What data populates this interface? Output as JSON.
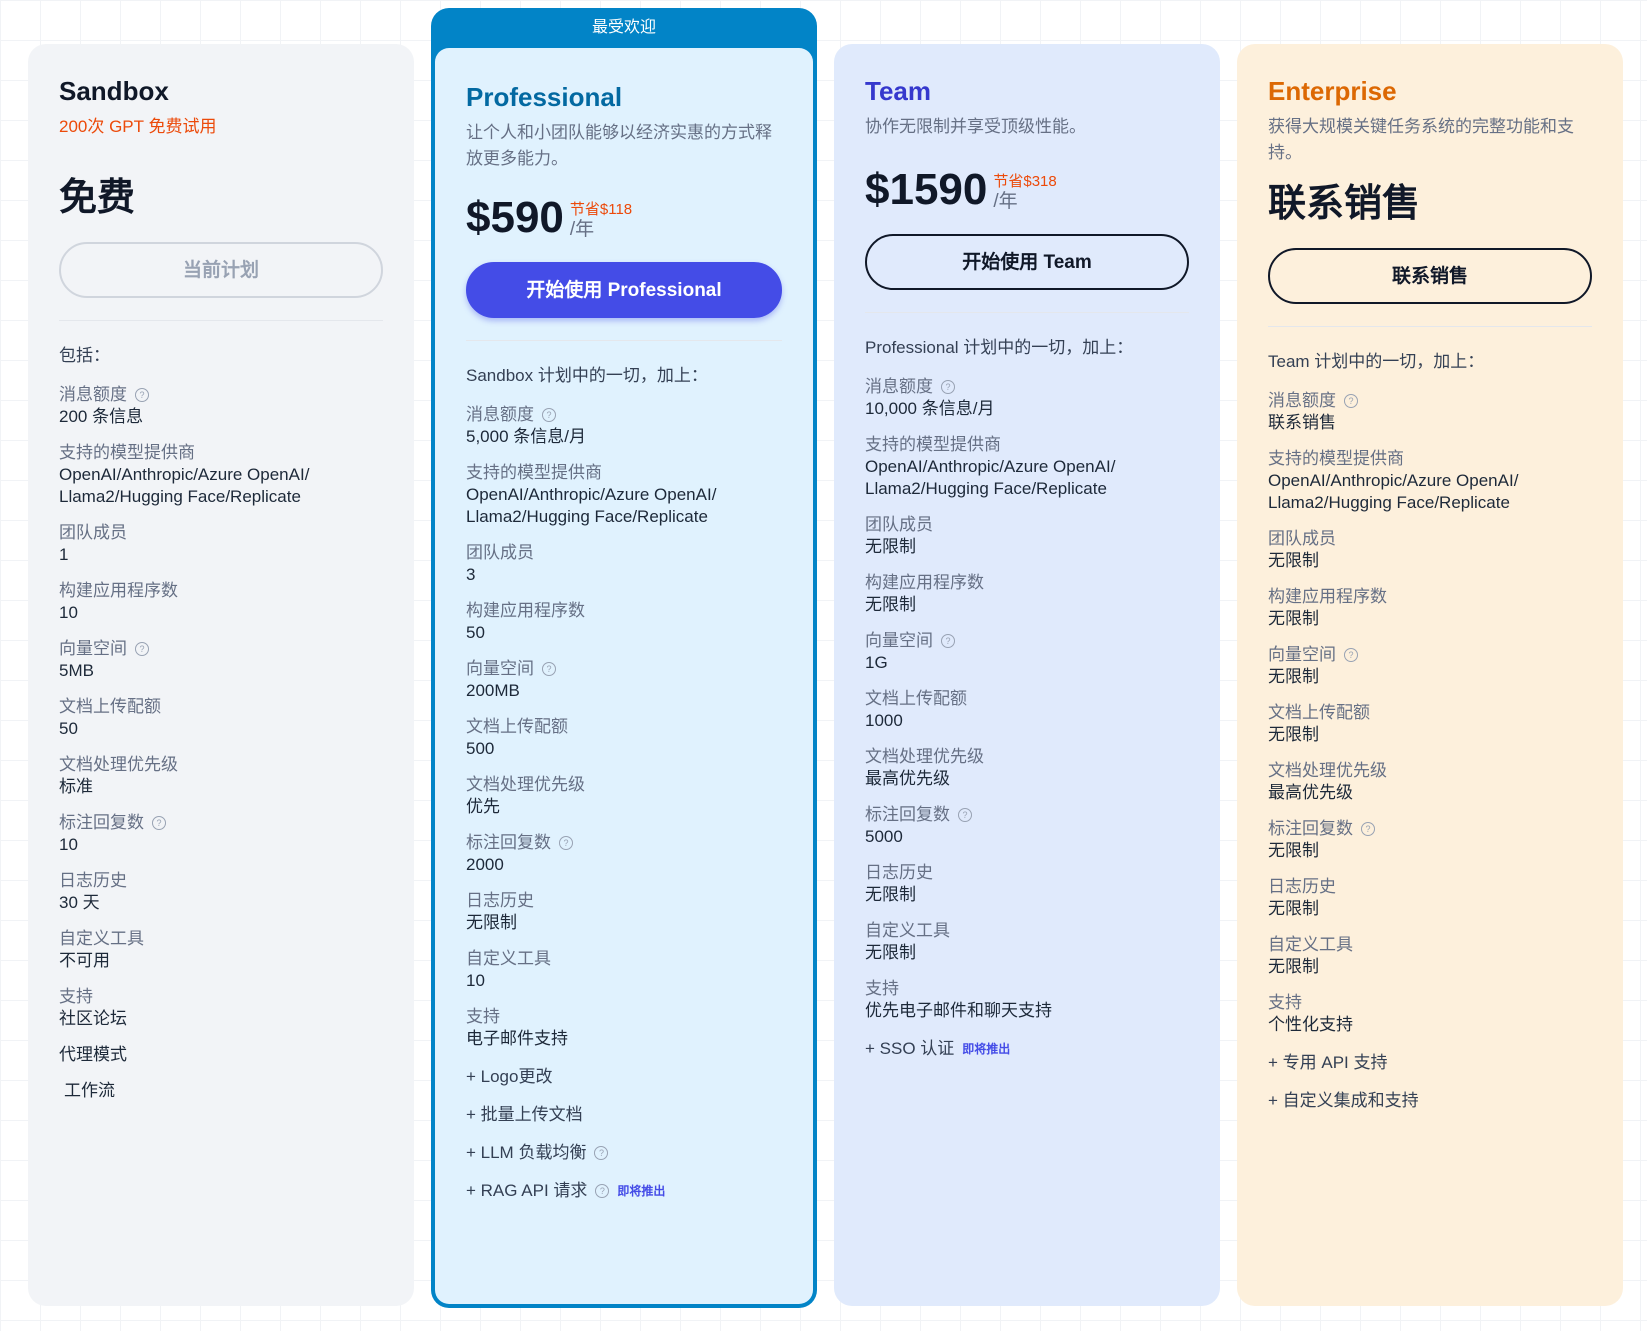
{
  "plans": {
    "sandbox": {
      "name": "Sandbox",
      "desc": "200次 GPT 免费试用",
      "price": "免费",
      "button": "当前计划",
      "includes": "包括：",
      "features": [
        {
          "label": "消息额度",
          "value": "200 条信息",
          "help": true
        },
        {
          "label": "支持的模型提供商",
          "value": "OpenAI/Anthropic/Azure OpenAI/\nLlama2/Hugging Face/Replicate",
          "help": false
        },
        {
          "label": "团队成员",
          "value": "1",
          "help": false
        },
        {
          "label": "构建应用程序数",
          "value": "10",
          "help": false
        },
        {
          "label": "向量空间",
          "value": "5MB",
          "help": true
        },
        {
          "label": "文档上传配额",
          "value": "50",
          "help": false
        },
        {
          "label": "文档处理优先级",
          "value": "标准",
          "help": false
        },
        {
          "label": "标注回复数",
          "value": "10",
          "help": true
        },
        {
          "label": "日志历史",
          "value": "30 天",
          "help": false
        },
        {
          "label": "自定义工具",
          "value": "不可用",
          "help": false
        },
        {
          "label": "支持",
          "value": "社区论坛",
          "help": false
        }
      ],
      "extras": [
        "代理模式",
        " 工作流"
      ]
    },
    "professional": {
      "badge": "最受欢迎",
      "name": "Professional",
      "desc": "让个人和小团队能够以经济实惠的方式释放更多能力。",
      "price": "$590",
      "save": "节省$118",
      "per": "/年",
      "button": "开始使用 Professional",
      "includes": "Sandbox 计划中的一切，加上：",
      "features": [
        {
          "label": "消息额度",
          "value": "5,000 条信息/月",
          "help": true
        },
        {
          "label": "支持的模型提供商",
          "value": "OpenAI/Anthropic/Azure OpenAI/\nLlama2/Hugging Face/Replicate",
          "help": false
        },
        {
          "label": "团队成员",
          "value": "3",
          "help": false
        },
        {
          "label": "构建应用程序数",
          "value": "50",
          "help": false
        },
        {
          "label": "向量空间",
          "value": "200MB",
          "help": true
        },
        {
          "label": "文档上传配额",
          "value": "500",
          "help": false
        },
        {
          "label": "文档处理优先级",
          "value": "优先",
          "help": false
        },
        {
          "label": "标注回复数",
          "value": "2000",
          "help": true
        },
        {
          "label": "日志历史",
          "value": "无限制",
          "help": false
        },
        {
          "label": "自定义工具",
          "value": "10",
          "help": false
        },
        {
          "label": "支持",
          "value": "电子邮件支持",
          "help": false
        }
      ],
      "extras": [
        {
          "text": "+ Logo更改",
          "help": false,
          "soon": ""
        },
        {
          "text": "+ 批量上传文档",
          "help": false,
          "soon": ""
        },
        {
          "text": "+ LLM 负载均衡",
          "help": true,
          "soon": ""
        },
        {
          "text": "+ RAG API 请求",
          "help": true,
          "soon": "即将推出"
        }
      ]
    },
    "team": {
      "name": "Team",
      "desc": "协作无限制并享受顶级性能。",
      "price": "$1590",
      "save": "节省$318",
      "per": "/年",
      "button": "开始使用 Team",
      "includes": "Professional 计划中的一切，加上：",
      "features": [
        {
          "label": "消息额度",
          "value": "10,000 条信息/月",
          "help": true
        },
        {
          "label": "支持的模型提供商",
          "value": "OpenAI/Anthropic/Azure OpenAI/\nLlama2/Hugging Face/Replicate",
          "help": false
        },
        {
          "label": "团队成员",
          "value": "无限制",
          "help": false
        },
        {
          "label": "构建应用程序数",
          "value": "无限制",
          "help": false
        },
        {
          "label": "向量空间",
          "value": "1G",
          "help": true
        },
        {
          "label": "文档上传配额",
          "value": "1000",
          "help": false
        },
        {
          "label": "文档处理优先级",
          "value": "最高优先级",
          "help": false
        },
        {
          "label": "标注回复数",
          "value": "5000",
          "help": true
        },
        {
          "label": "日志历史",
          "value": "无限制",
          "help": false
        },
        {
          "label": "自定义工具",
          "value": "无限制",
          "help": false
        },
        {
          "label": "支持",
          "value": "优先电子邮件和聊天支持",
          "help": false
        }
      ],
      "extras": [
        {
          "text": "+ SSO 认证",
          "help": false,
          "soon": "即将推出"
        }
      ]
    },
    "enterprise": {
      "name": "Enterprise",
      "desc": "获得大规模关键任务系统的完整功能和支持。",
      "price": "联系销售",
      "button": "联系销售",
      "includes": "Team 计划中的一切，加上：",
      "features": [
        {
          "label": "消息额度",
          "value": "联系销售",
          "help": true
        },
        {
          "label": "支持的模型提供商",
          "value": "OpenAI/Anthropic/Azure OpenAI/\nLlama2/Hugging Face/Replicate",
          "help": false
        },
        {
          "label": "团队成员",
          "value": "无限制",
          "help": false
        },
        {
          "label": "构建应用程序数",
          "value": "无限制",
          "help": false
        },
        {
          "label": "向量空间",
          "value": "无限制",
          "help": true
        },
        {
          "label": "文档上传配额",
          "value": "无限制",
          "help": false
        },
        {
          "label": "文档处理优先级",
          "value": "最高优先级",
          "help": false
        },
        {
          "label": "标注回复数",
          "value": "无限制",
          "help": true
        },
        {
          "label": "日志历史",
          "value": "无限制",
          "help": false
        },
        {
          "label": "自定义工具",
          "value": "无限制",
          "help": false
        },
        {
          "label": "支持",
          "value": "个性化支持",
          "help": false
        }
      ],
      "extras": [
        {
          "text": "+ 专用 API 支持",
          "help": false,
          "soon": ""
        },
        {
          "text": "+ 自定义集成和支持",
          "help": false,
          "soon": ""
        }
      ]
    }
  },
  "icons": {
    "help": "?"
  },
  "colors": {
    "primary_button": "#444ce7",
    "popular_border": "#0284c7",
    "saving": "#ec4a0a",
    "enterprise_title": "#dc6803",
    "team_title": "#3538cd",
    "professional_title": "#0369a1"
  }
}
